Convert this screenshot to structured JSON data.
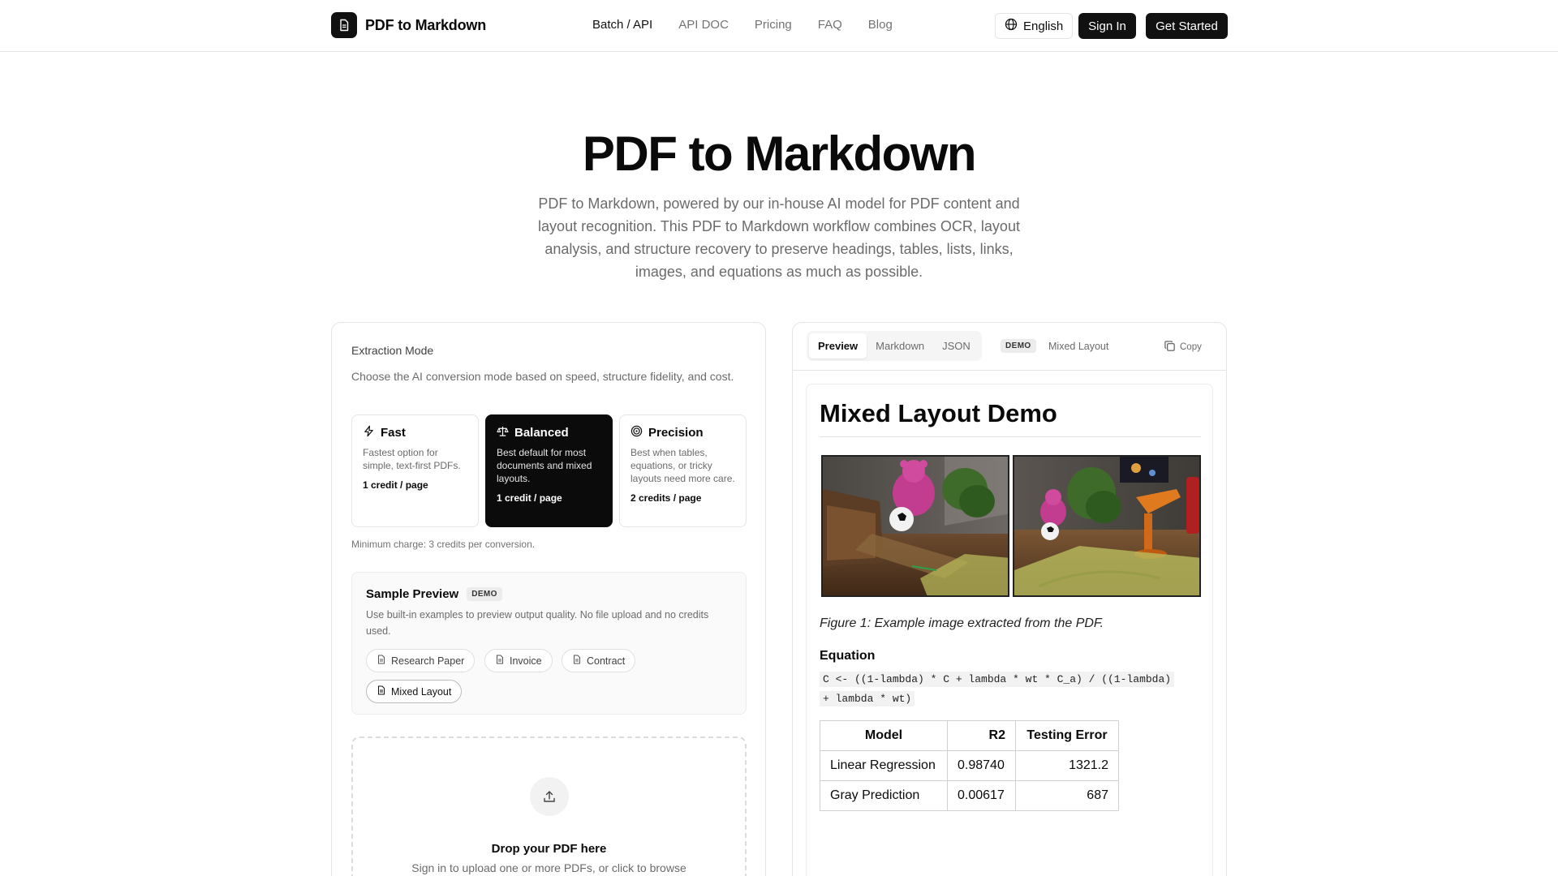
{
  "header": {
    "brand": "PDF to Markdown",
    "nav": [
      {
        "label": "Batch / API",
        "active": true
      },
      {
        "label": "API DOC",
        "active": false
      },
      {
        "label": "Pricing",
        "active": false
      },
      {
        "label": "FAQ",
        "active": false
      },
      {
        "label": "Blog",
        "active": false
      }
    ],
    "language": "English",
    "sign_in": "Sign In",
    "get_started": "Get Started"
  },
  "hero": {
    "title": "PDF to Markdown",
    "subtitle": "PDF to Markdown, powered by our in-house AI model for PDF content and layout recognition. This PDF to Markdown workflow combines OCR, layout analysis, and structure recovery to preserve headings, tables, lists, links, images, and equations as much as possible."
  },
  "extraction": {
    "title": "Extraction Mode",
    "description": "Choose the AI conversion mode based on speed, structure fidelity, and cost.",
    "modes": [
      {
        "name": "Fast",
        "icon": "bolt-icon",
        "desc": "Fastest option for simple, text-first PDFs.",
        "cost": "1 credit / page",
        "selected": false
      },
      {
        "name": "Balanced",
        "icon": "scale-icon",
        "desc": "Best default for most documents and mixed layouts.",
        "cost": "1 credit / page",
        "selected": true
      },
      {
        "name": "Precision",
        "icon": "target-icon",
        "desc": "Best when tables, equations, or tricky layouts need more care.",
        "cost": "2 credits / page",
        "selected": false
      }
    ],
    "min_charge": "Minimum charge: 3 credits per conversion."
  },
  "sample": {
    "title": "Sample Preview",
    "tag": "DEMO",
    "description": "Use built-in examples to preview output quality. No file upload and no credits used.",
    "chips": [
      "Research Paper",
      "Invoice",
      "Contract",
      "Mixed Layout"
    ],
    "selected": "Mixed Layout"
  },
  "dropzone": {
    "title": "Drop your PDF here",
    "subtitle": "Sign in to upload one or more PDFs, or click to browse"
  },
  "output": {
    "tabs": [
      "Preview",
      "Markdown",
      "JSON"
    ],
    "active_tab": "Preview",
    "tag": "DEMO",
    "sample_name": "Mixed Layout",
    "copy": "Copy",
    "doc": {
      "title": "Mixed Layout Demo",
      "caption": "Figure 1: Example image extracted from the PDF.",
      "equation_heading": "Equation",
      "equation_line1": "C <- ((1-lambda) * C + lambda * wt * C_a) / ((1-lambda)",
      "equation_line2": "+ lambda * wt)",
      "table": {
        "headers": [
          "Model",
          "R2",
          "Testing Error"
        ],
        "rows": [
          [
            "Linear Regression",
            "0.98740",
            "1321.2"
          ],
          [
            "Gray Prediction",
            "0.00617",
            "687"
          ]
        ]
      }
    }
  }
}
